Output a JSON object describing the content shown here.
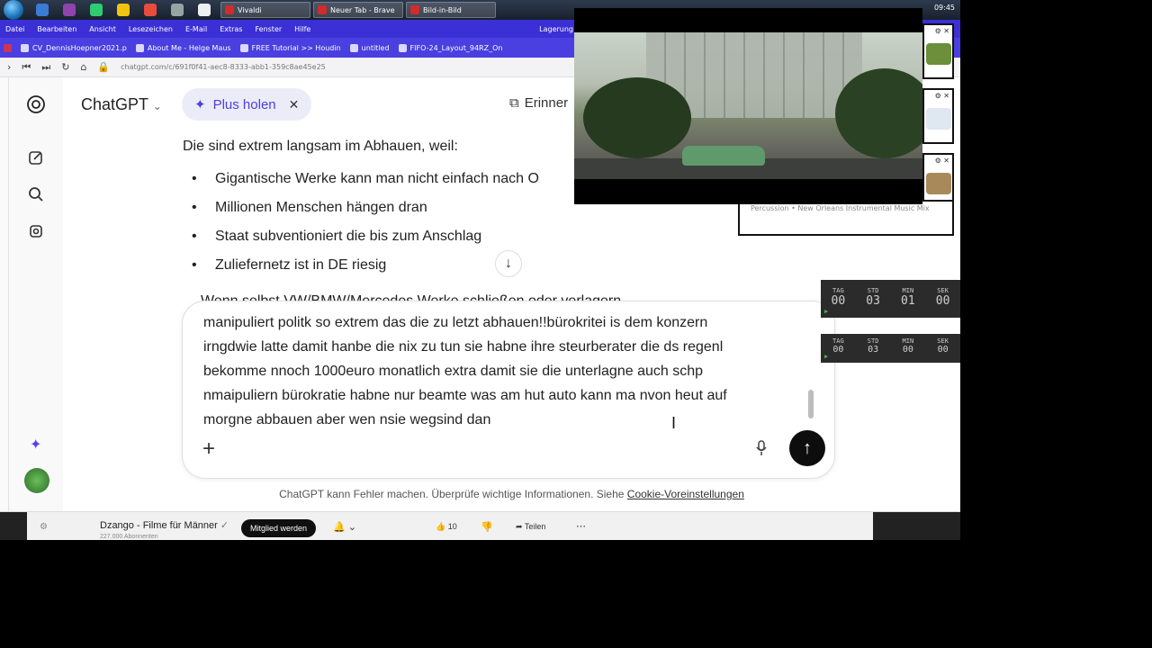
{
  "taskbar": {
    "tasks": [
      "Vivaldi",
      "Neuer Tab - Brave",
      "Bild-in-Bild"
    ],
    "clock": "09:45"
  },
  "menubar": {
    "items": [
      "Datei",
      "Bearbeiten",
      "Ansicht",
      "Lesezeichen",
      "E-Mail",
      "Extras",
      "Fenster",
      "Hilfe"
    ],
    "right_item": "Lagerung"
  },
  "bookmarks": [
    "CV_DennisHoepner2021.p",
    "About Me - Helge Maus",
    "FREE Tutorial >> Houdin",
    "untitled",
    "FIFO-24_Layout_94RZ_On"
  ],
  "address": {
    "url": "chatgpt.com/c/691f0f41-aec8-8333-abb1-359c8ae45e25"
  },
  "header": {
    "title": "ChatGPT",
    "plus_label": "Plus holen",
    "memory_label": "Erinner"
  },
  "conversation": {
    "intro": "Die sind extrem langsam im Abhauen, weil:",
    "bullets": [
      "Gigantische Werke kann man nicht einfach nach O",
      "Millionen Menschen hängen dran",
      "Staat subventioniert die bis zum Anschlag",
      "Zuliefernetz ist in DE riesig"
    ],
    "cut_line": "Wenn selbst VW/BMW/Mercedes Werke schließen oder verlagern"
  },
  "composer": {
    "text": "manipuliert politk so extrem  das die zu letzt abhauen!!bürokritei is dem konzern\nirngdwie latte damit hanbe die nix zu tun sie habne ihre steurberater   die ds regenl\nbekomme nnoch 1000euro monatlich extra damit sie die unterlagne auch schp\nnmaipuliern  bürokratie habne nur beamte was am hut auto kann ma nvon heut auf\nmorgne abbauen  aber   wen nsie wegsind dan"
  },
  "disclaimer": {
    "text": "ChatGPT kann Fehler machen. Überprüfe wichtige Informationen. Siehe ",
    "link": "Cookie-Voreinstellungen"
  },
  "youtube": {
    "channel": "Dzango - Filme für Männer",
    "subscribers": "227.000 Abonnenten",
    "join_label": "Mitglied werden",
    "likes": "10",
    "share_label": "Teilen"
  },
  "now_playing": {
    "text": "Percussion • New Orleans Instrumental Music Mix"
  },
  "timers": [
    {
      "labels": [
        "TAG",
        "STD",
        "MIN",
        "SEK"
      ],
      "values": [
        "00",
        "03",
        "01",
        "00"
      ]
    },
    {
      "labels": [
        "TAG",
        "STD",
        "MIN",
        "SEK"
      ],
      "values": [
        "00",
        "03",
        "00",
        "00"
      ]
    }
  ]
}
